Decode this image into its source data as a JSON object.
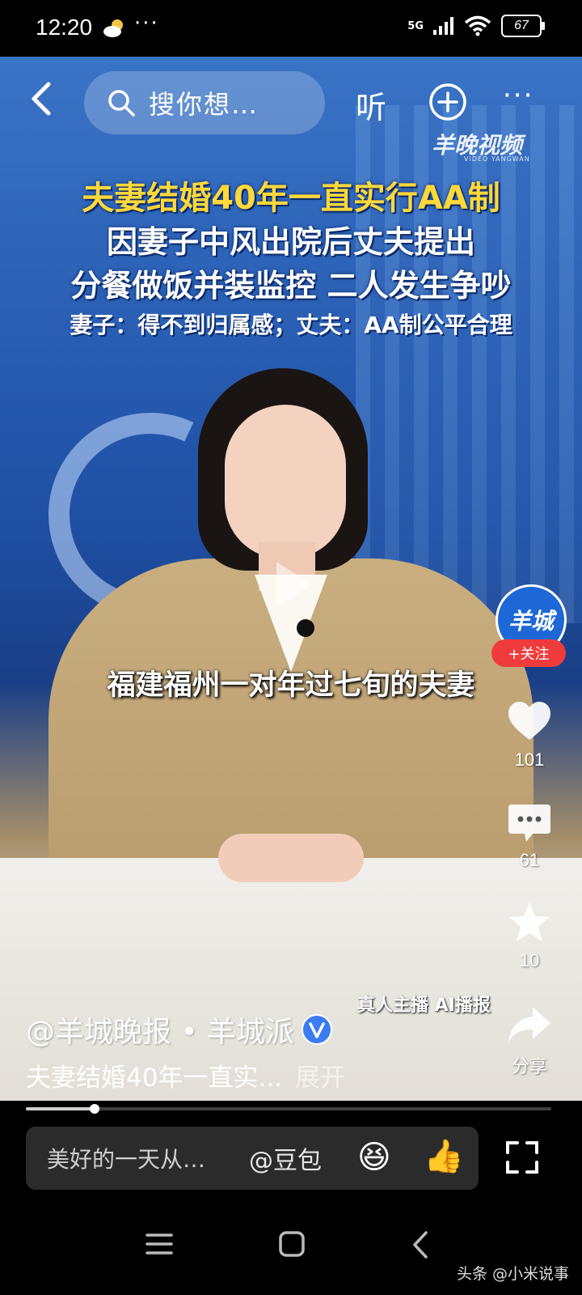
{
  "status_bar": {
    "time": "12:20",
    "overflow": "···",
    "network": "5G",
    "battery": "67",
    "icons": [
      "weather-partly-cloudy-icon",
      "signal-icon",
      "wifi-icon",
      "battery-icon"
    ]
  },
  "top_bar": {
    "search_placeholder": "搜你想…",
    "listen_label": "听",
    "more_label": "···"
  },
  "video": {
    "brand": "羊晚视频",
    "brand_sub": "VIDEO YANGWAN",
    "headline_line1": "夫妻结婚40年一直实行AA制",
    "headline_line2": "因妻子中风出院后丈夫提出",
    "headline_line3": "分餐做饭并装监控 二人发生争吵",
    "headline_line4": "妻子：得不到归属感；丈夫：AA制公平合理",
    "subtitle": "福建福州一对年过七旬的夫妻",
    "ai_tag": "真人主播 AI播报",
    "progress": 0.13
  },
  "right_rail": {
    "avatar_text": "羊城",
    "follow_label": "+关注",
    "like_count": "101",
    "comment_count": "61",
    "favorite_count": "10",
    "share_label": "分享"
  },
  "info": {
    "author": "@羊城晚报 • 羊城派",
    "caption": "夫妻结婚40年一直实...",
    "expand_label": "展开"
  },
  "input_bar": {
    "placeholder": "美好的一天从…",
    "mention": "@豆包",
    "emoji": "😆",
    "thumb": "👍"
  },
  "watermark": "头条 @小米说事",
  "colors": {
    "headline_yellow": "#ffd83a",
    "follow_red": "#ef3b3b",
    "verified_blue": "#3b7cf0"
  }
}
